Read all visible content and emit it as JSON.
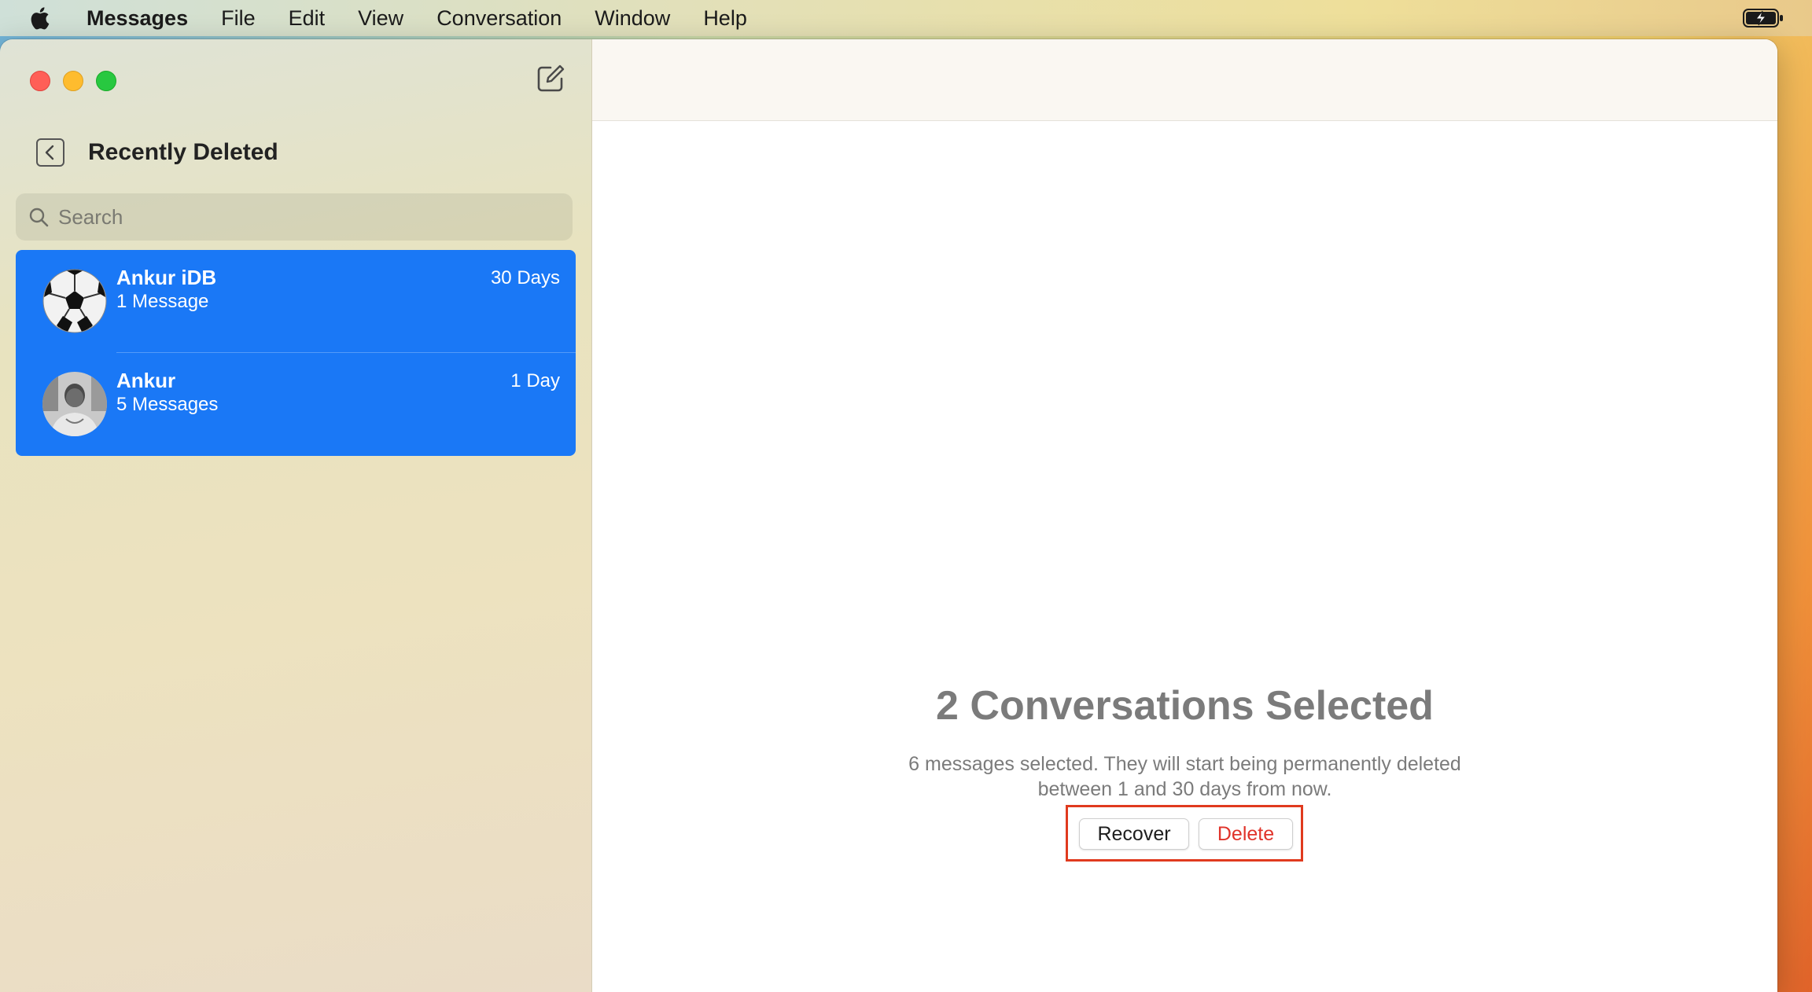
{
  "menubar": {
    "app_name": "Messages",
    "items": [
      "File",
      "Edit",
      "View",
      "Conversation",
      "Window",
      "Help"
    ]
  },
  "sidebar": {
    "title": "Recently Deleted",
    "search": {
      "placeholder": "Search"
    },
    "conversations": [
      {
        "name": "Ankur iDB",
        "subtitle": "1 Message",
        "age": "30 Days",
        "avatar": "soccer-ball"
      },
      {
        "name": "Ankur",
        "subtitle": "5 Messages",
        "age": "1 Day",
        "avatar": "person-photo"
      }
    ]
  },
  "detail": {
    "title": "2 Conversations Selected",
    "description_line1": "6 messages selected. They will start being permanently deleted",
    "description_line2": "between 1 and 30 days from now.",
    "recover_label": "Recover",
    "delete_label": "Delete"
  },
  "colors": {
    "selection": "#1a78f6",
    "delete_text": "#e0332a",
    "highlight_box": "#e03a1e"
  }
}
